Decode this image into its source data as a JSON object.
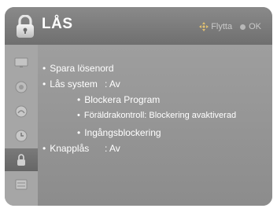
{
  "header": {
    "title": "LÅS",
    "move_hint": "Flytta",
    "ok_hint": "OK",
    "move_icon": "four-way-arrows-icon",
    "ok_icon": "ok-dot-icon"
  },
  "sidebar": {
    "items": [
      {
        "icon": "picture-icon"
      },
      {
        "icon": "audio-icon"
      },
      {
        "icon": "setup-icon"
      },
      {
        "icon": "time-icon"
      },
      {
        "icon": "lock-icon",
        "active": true
      },
      {
        "icon": "option-icon"
      }
    ]
  },
  "menu": {
    "items": [
      {
        "label": "Spara lösenord",
        "value": ""
      },
      {
        "label": "Lås system",
        "value": ": Av"
      },
      {
        "label": "Blockera Program",
        "value": ""
      },
      {
        "label": "Föräldrakontroll: Blockering avaktiverad",
        "value": ""
      },
      {
        "label": "Ingångsblockering",
        "value": ""
      },
      {
        "label": "Knapplås",
        "value": ": Av"
      }
    ]
  },
  "colors": {
    "header": "#7c7c7c",
    "content": "#969696",
    "text": "#ffffff"
  }
}
